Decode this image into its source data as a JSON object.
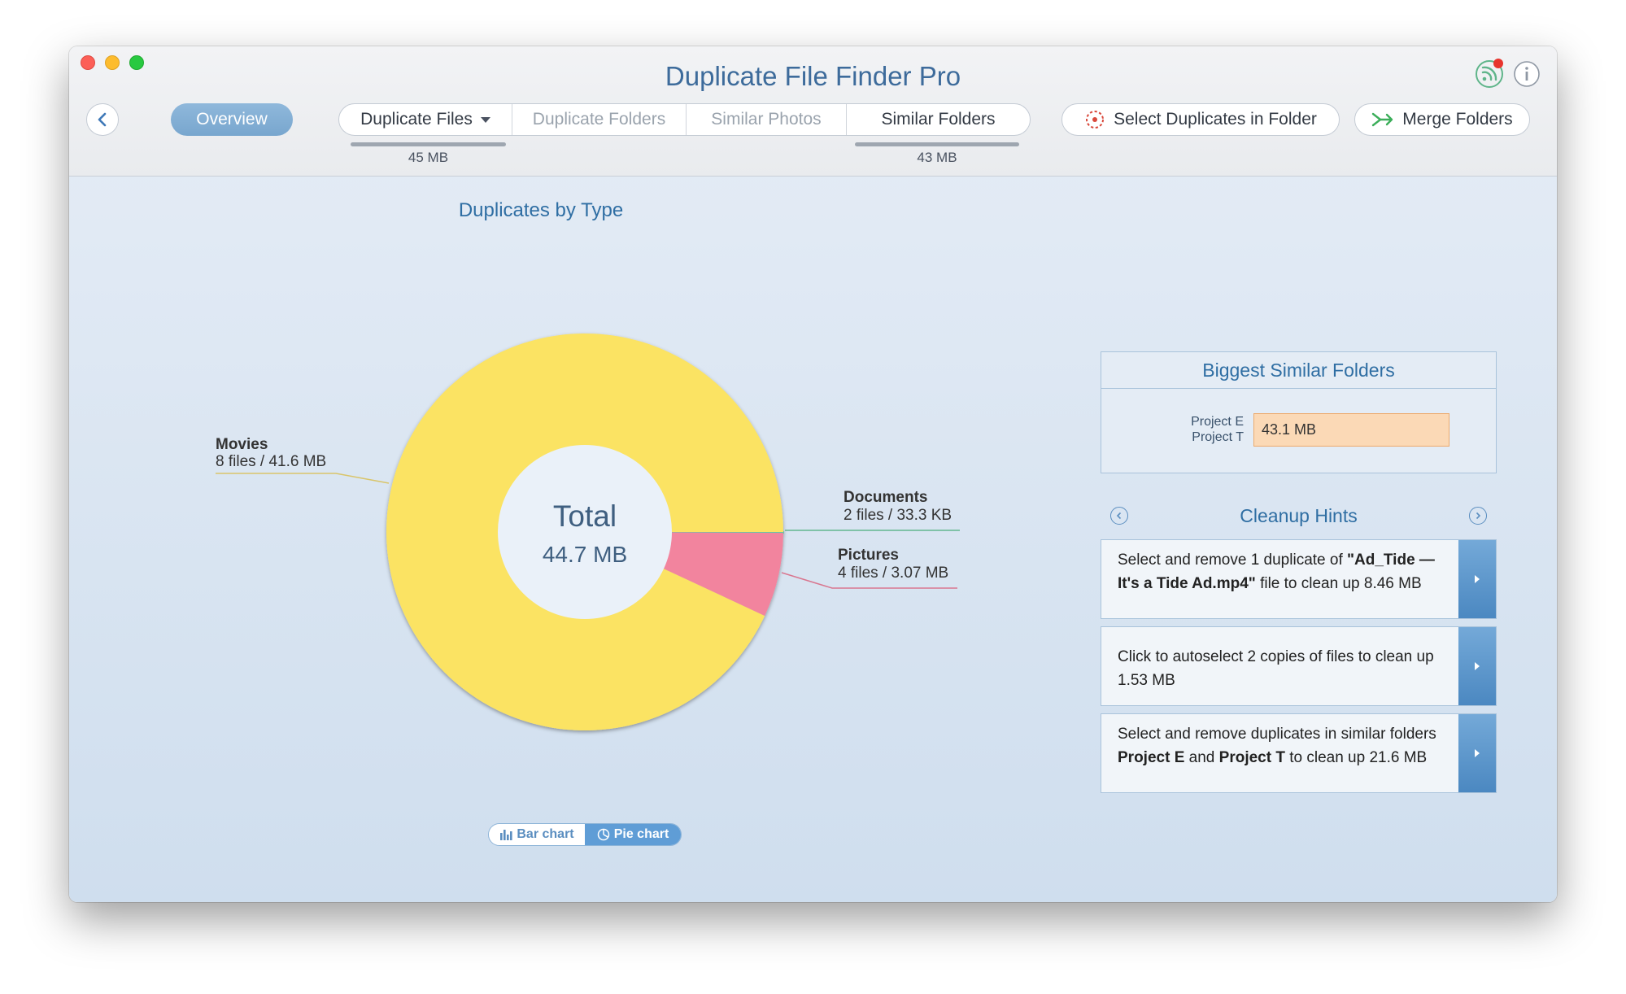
{
  "app": {
    "title": "Duplicate File Finder Pro"
  },
  "toolbar": {
    "overview_label": "Overview",
    "tabs": [
      {
        "label": "Duplicate Files",
        "size": "45 MB",
        "state": "active"
      },
      {
        "label": "Duplicate Folders",
        "state": "dim"
      },
      {
        "label": "Similar Photos",
        "state": "dim"
      },
      {
        "label": "Similar Folders",
        "size": "43 MB",
        "state": "active"
      }
    ],
    "select_duplicates_label": "Select Duplicates in Folder",
    "merge_folders_label": "Merge Folders"
  },
  "chart_data": {
    "type": "pie",
    "title": "Duplicates by Type",
    "center_label": "Total",
    "center_value": "44.7 MB",
    "slices": [
      {
        "name": "Movies",
        "detail": "8 files / 41.6 MB",
        "value": 41.6,
        "color": "#fbe363"
      },
      {
        "name": "Documents",
        "detail": "2 files / 33.3 KB",
        "value": 0.0333,
        "color": "#6cc4a4"
      },
      {
        "name": "Pictures",
        "detail": "4 files / 3.07 MB",
        "value": 3.07,
        "color": "#f2849e"
      }
    ]
  },
  "chart_toggle": {
    "bar_label": "Bar chart",
    "pie_label": "Pie chart",
    "selected": "pie"
  },
  "biggest_folders": {
    "title": "Biggest Similar Folders",
    "folder_a": "Project E",
    "folder_b": "Project T",
    "size": "43.1 MB",
    "bar_color": "#fbd9b6"
  },
  "cleanup_hints": {
    "title": "Cleanup Hints",
    "hints": [
      {
        "p1": "Select and remove 1 duplicate of ",
        "b1": "\"Ad_Tide — It's a Tide Ad.mp4\"",
        "p2": " file to clean up 8.46 MB"
      },
      {
        "p1": "Click to autoselect 2 copies of files to clean up 1.53 MB"
      },
      {
        "p1": "Select and remove duplicates in similar folders ",
        "b1": "Project E",
        "p2": " and ",
        "b2": "Project T",
        "p3": " to clean up 21.6 MB"
      }
    ]
  },
  "colors": {
    "accent": "#2f6ea3",
    "overview_bg": "#8fb8db",
    "hint_button": "#4b88c1"
  }
}
